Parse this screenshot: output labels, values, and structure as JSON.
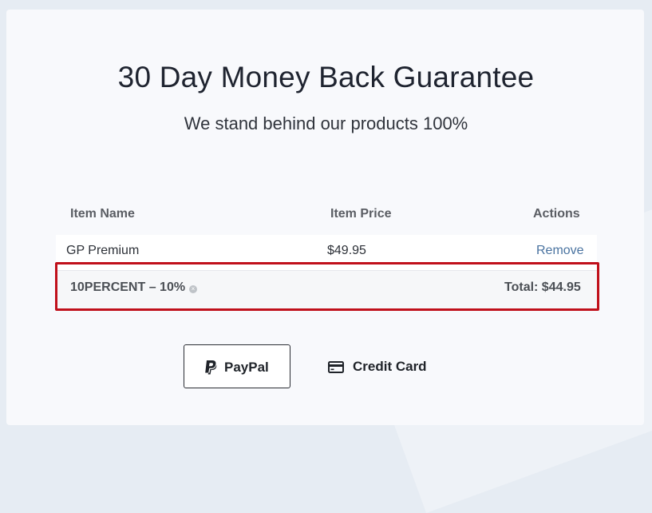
{
  "header": {
    "title": "30 Day Money Back Guarantee",
    "subtitle": "We stand behind our products 100%"
  },
  "cart": {
    "columns": {
      "name": "Item Name",
      "price": "Item Price",
      "actions": "Actions"
    },
    "items": [
      {
        "name": "GP Premium",
        "price": "$49.95",
        "action_label": "Remove"
      }
    ],
    "discount": {
      "code_label": "10PERCENT – 10%",
      "remove_icon": "remove-discount-icon",
      "total_label": "Total: $44.95"
    },
    "highlight_color": "#c0101b",
    "link_color": "#4a73a0"
  },
  "payment": {
    "paypal_label": "PayPal",
    "paypal_icon": "paypal-icon",
    "credit_card_label": "Credit Card",
    "credit_card_icon": "credit-card-icon"
  }
}
